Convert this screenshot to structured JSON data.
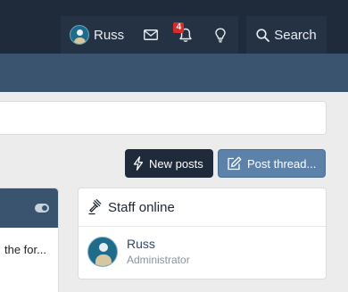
{
  "header": {
    "username": "Russ",
    "alerts_count": "4",
    "search_label": "Search"
  },
  "buttons": {
    "new_posts": "New posts",
    "post_thread": "Post thread..."
  },
  "left_panel": {
    "snippet": "the for..."
  },
  "staff_online": {
    "title": "Staff online",
    "members": [
      {
        "name": "Russ",
        "role": "Administrator"
      }
    ]
  },
  "colors": {
    "header_bg": "#1f2a3a",
    "subnav_bg": "#3a5470",
    "accent_button": "#5c82aa",
    "dark_button": "#1f2a3a",
    "alert_badge": "#d52b2b"
  },
  "icons": [
    "avatar",
    "envelope-icon",
    "bell-icon",
    "lightbulb-icon",
    "search-icon",
    "lightning-icon",
    "pencil-square-icon",
    "gavel-icon",
    "toggle-icon"
  ]
}
